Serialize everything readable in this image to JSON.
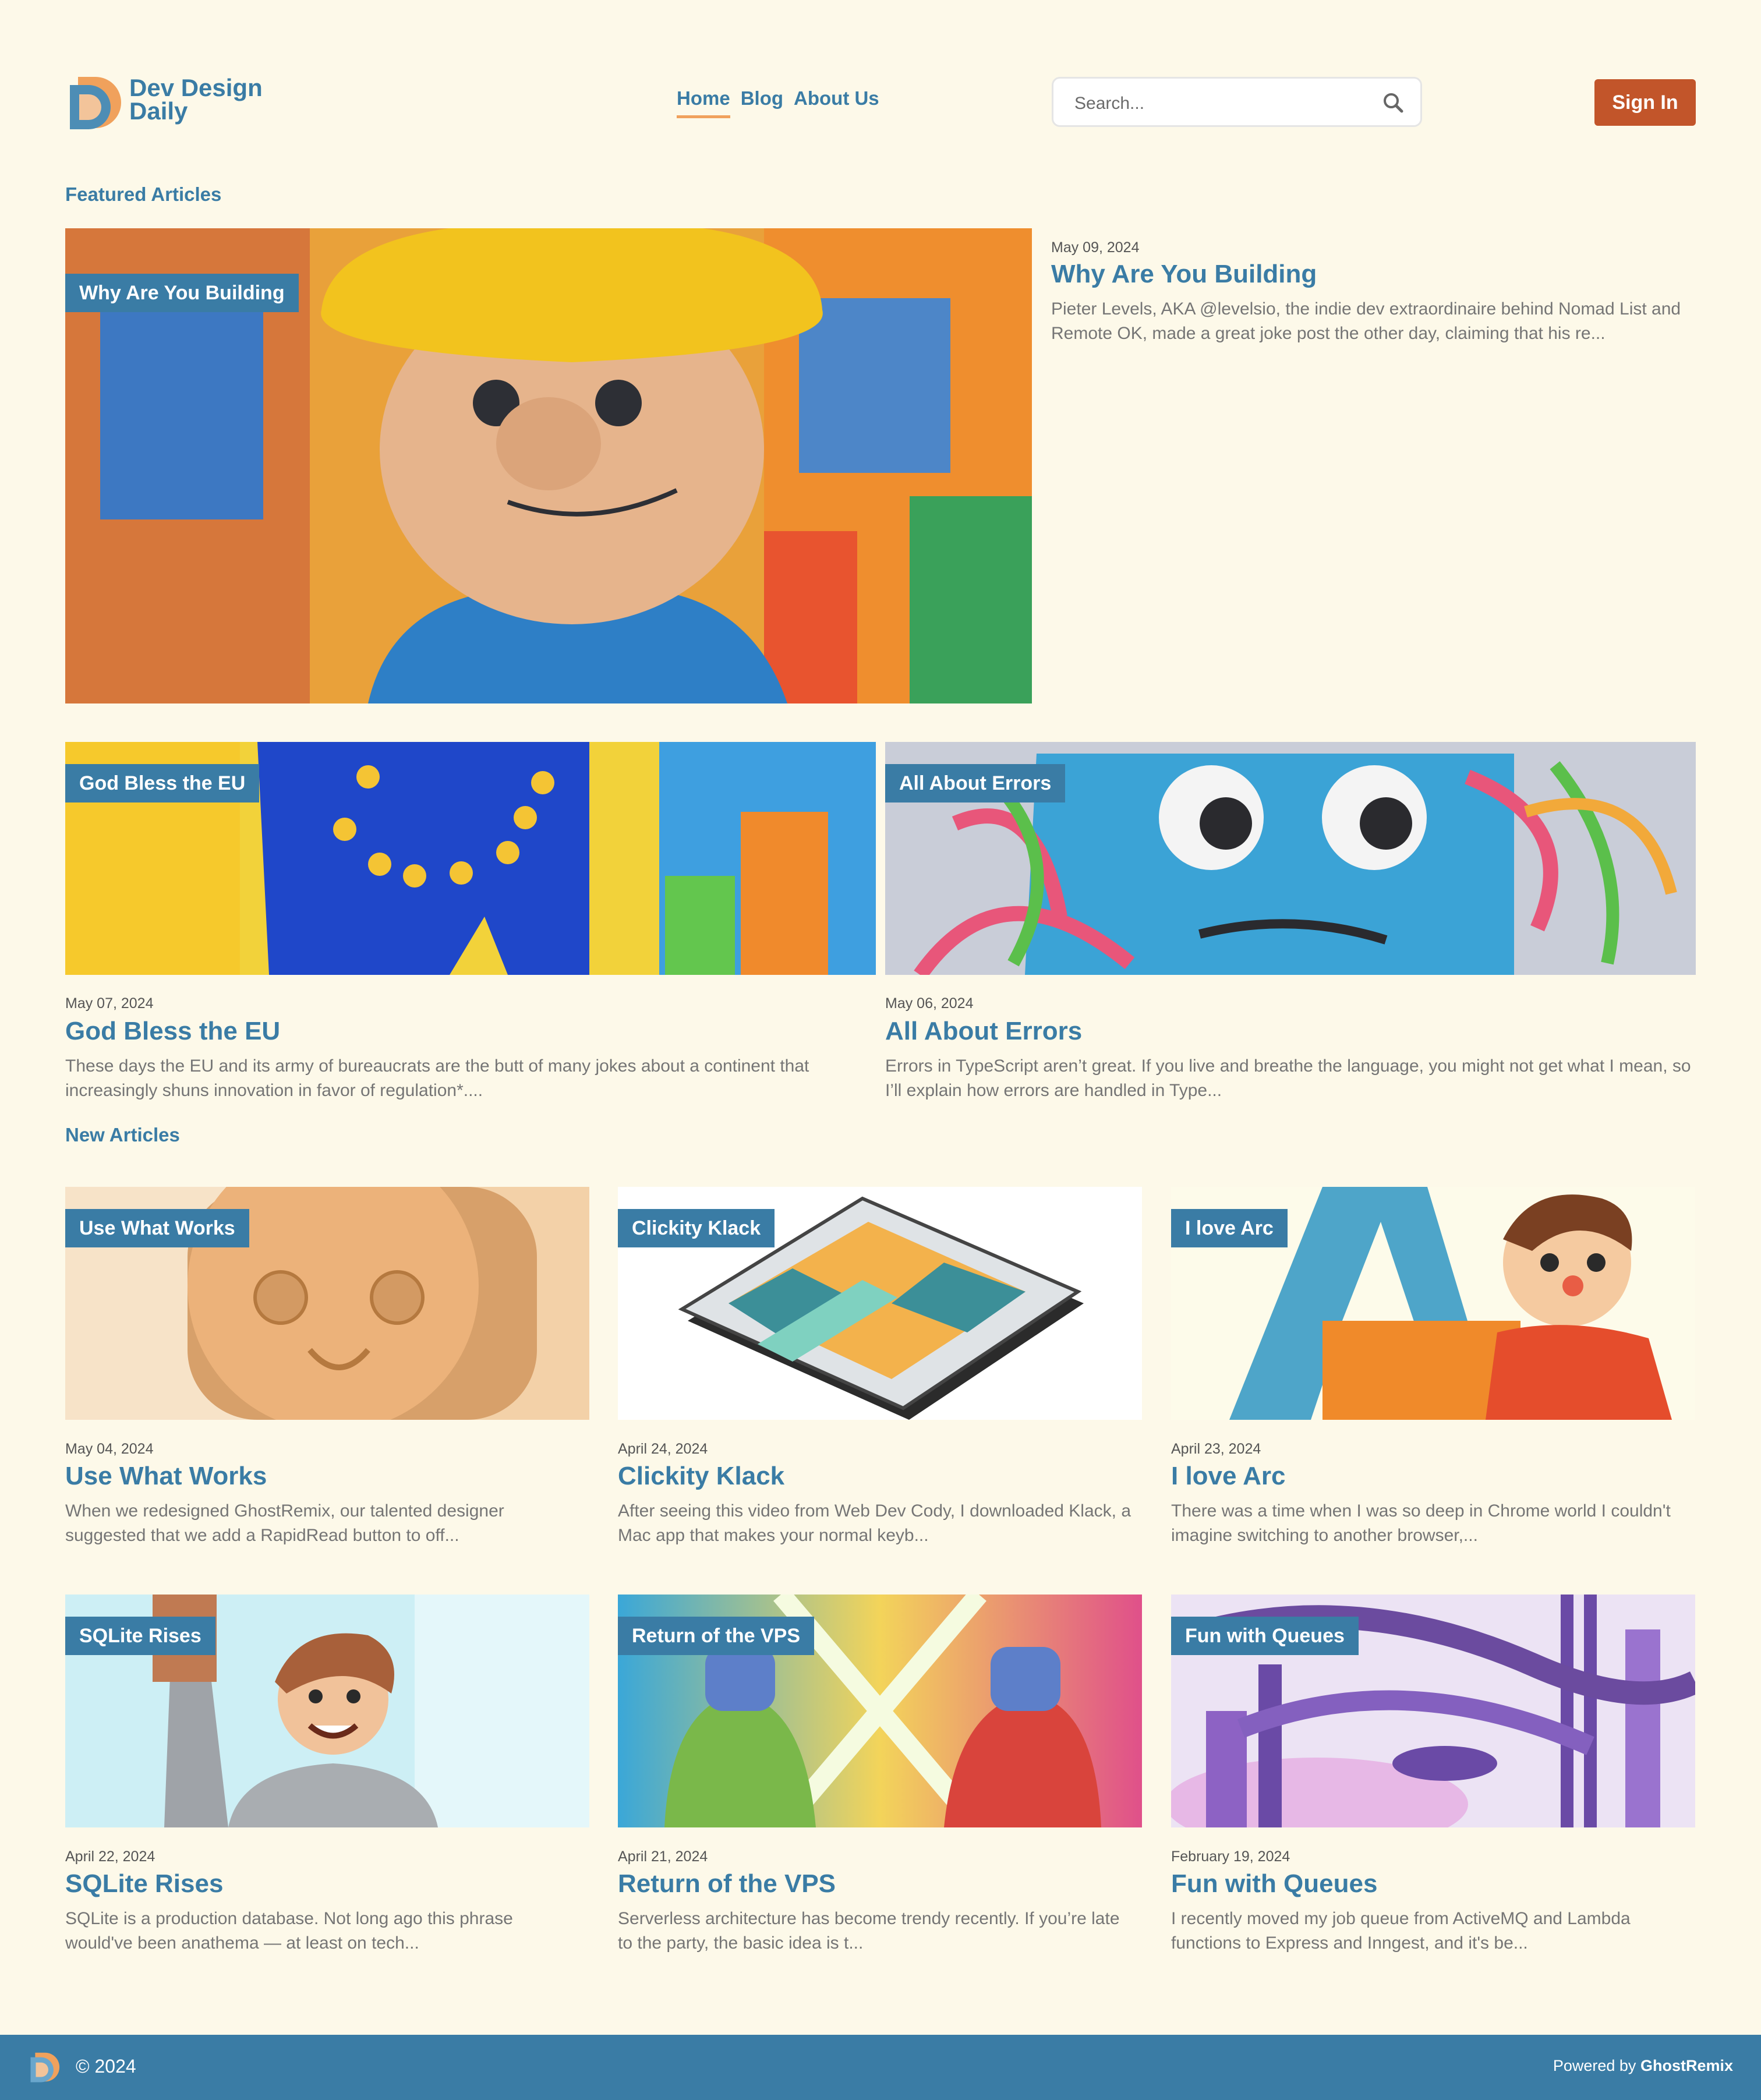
{
  "brand": {
    "name_line1": "Dev Design",
    "name_line2": "Daily"
  },
  "nav": {
    "home": "Home",
    "blog": "Blog",
    "about": "About Us"
  },
  "search": {
    "placeholder": "Search..."
  },
  "signin": {
    "label": "Sign In"
  },
  "sections": {
    "featured": "Featured Articles",
    "new": "New Articles"
  },
  "featured": [
    {
      "tag": "Why Are You Building",
      "date": "May 09, 2024",
      "title": "Why Are You Building",
      "excerpt": "Pieter Levels, AKA @levelsio, the indie dev extraordinaire behind Nomad List and Remote OK, made a great joke post the other day, claiming that his re..."
    },
    {
      "tag": "God Bless the EU",
      "date": "May 07, 2024",
      "title": "God Bless the EU",
      "excerpt": "These days the EU and its army of bureaucrats are the butt of many jokes about a continent that increasingly shuns innovation in favor of regulation*...."
    },
    {
      "tag": "All About Errors",
      "date": "May 06, 2024",
      "title": "All About Errors",
      "excerpt": "Errors in TypeScript aren’t great. If you live and breathe the language, you might not get what I mean, so I’ll explain how errors are handled in Type..."
    }
  ],
  "articles": [
    {
      "tag": "Use What Works",
      "date": "May 04, 2024",
      "title": "Use What Works",
      "excerpt": "When we redesigned GhostRemix, our talented designer suggested that we add a RapidRead button to off..."
    },
    {
      "tag": "Clickity Klack",
      "date": "April 24, 2024",
      "title": "Clickity Klack",
      "excerpt": "After seeing this video from Web Dev Cody, I downloaded Klack, a Mac app that makes your normal keyb..."
    },
    {
      "tag": "I love Arc",
      "date": "April 23, 2024",
      "title": "I love Arc",
      "excerpt": "There was a time when I was so deep in Chrome world I couldn't imagine switching to another browser,..."
    },
    {
      "tag": "SQLite Rises",
      "date": "April 22, 2024",
      "title": "SQLite Rises",
      "excerpt": "SQLite is a production database. Not long ago this phrase would've been anathema — at least on tech..."
    },
    {
      "tag": "Return of the VPS",
      "date": "April 21, 2024",
      "title": "Return of the VPS",
      "excerpt": "Serverless architecture has become trendy recently. If you’re late to the party, the basic idea is t..."
    },
    {
      "tag": "Fun with Queues",
      "date": "February 19, 2024",
      "title": "Fun with Queues",
      "excerpt": "I recently moved my job queue from ActiveMQ and Lambda functions to Express and Inngest, and it's be..."
    }
  ],
  "footer": {
    "copyright": "© 2024",
    "powered_prefix": "Powered by",
    "powered_brand": "GhostRemix"
  },
  "colors": {
    "background": "#fdf9e9",
    "primary": "#3a7ca5",
    "accent": "#c2552a",
    "underline": "#f0a15c"
  },
  "icons": {
    "search": "search-icon",
    "logo": "dd-logo-icon"
  }
}
